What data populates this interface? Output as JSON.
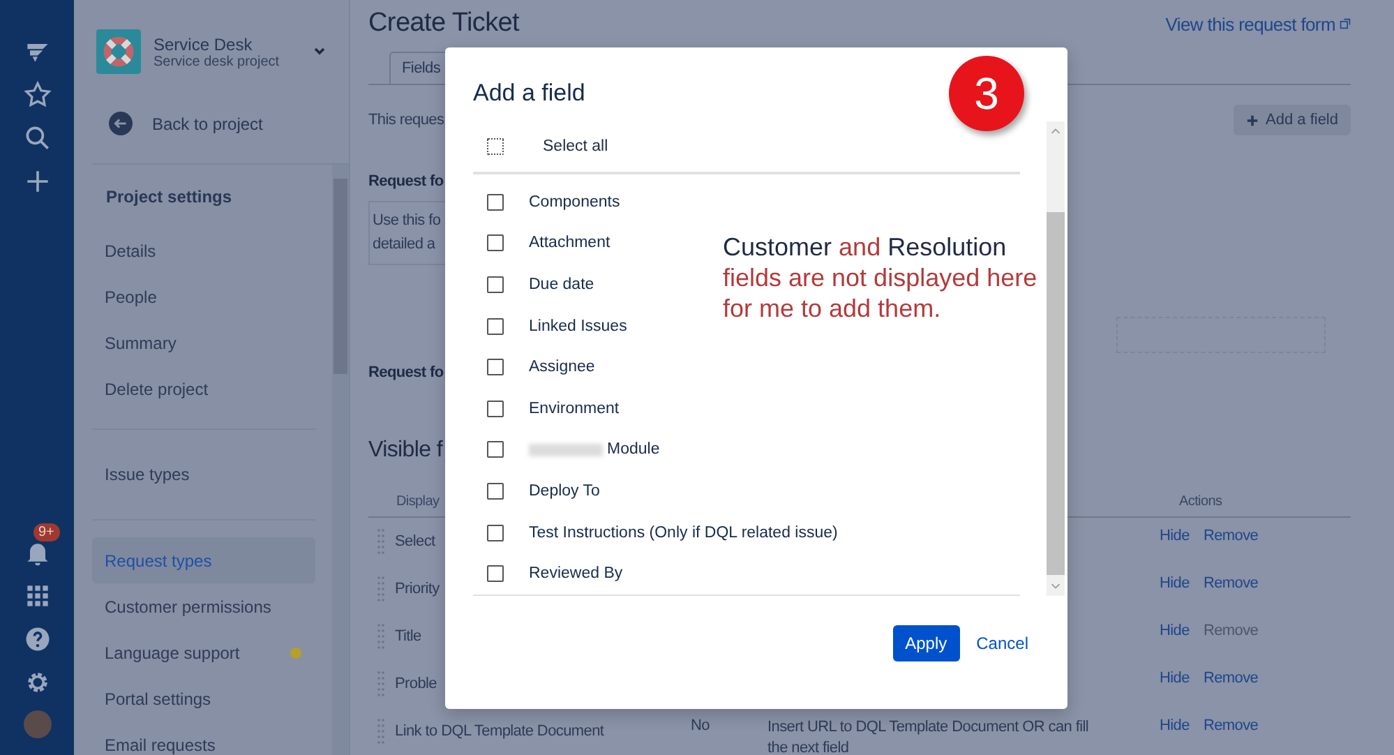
{
  "nav": {
    "badge": "9+"
  },
  "sidebar": {
    "project_name": "Service Desk",
    "project_type": "Service desk project",
    "back_link": "Back to project",
    "groups": [
      {
        "heading": "Project settings",
        "items": [
          {
            "label": "Details",
            "selected": false
          },
          {
            "label": "People",
            "selected": false
          },
          {
            "label": "Summary",
            "selected": false
          },
          {
            "label": "Delete project",
            "selected": false
          }
        ]
      },
      {
        "items": [
          {
            "label": "Issue types",
            "selected": false
          }
        ]
      },
      {
        "items": [
          {
            "label": "Request types",
            "selected": true
          },
          {
            "label": "Customer permissions",
            "selected": false
          },
          {
            "label": "Language support",
            "selected": false,
            "dot": {
              "color": "#b5a02a"
            }
          },
          {
            "label": "Portal settings",
            "selected": false
          },
          {
            "label": "Email requests",
            "selected": false
          }
        ]
      }
    ]
  },
  "page": {
    "title": "Create Ticket",
    "view_link": "View this request form",
    "tabs": [
      {
        "label": "Fields",
        "selected": true
      }
    ],
    "intro": "This reques",
    "add_field_button": "Add a field",
    "form_label_1": "Request fo",
    "description_lines": [
      "Use this fo",
      "detailed a"
    ],
    "form_label_2": "Request fo",
    "section_heading": "Visible f",
    "table": {
      "columns": [
        "Display",
        "Actions"
      ],
      "rows": [
        {
          "name": "Select",
          "actions": [
            {
              "label": "Hide",
              "disabled": false
            },
            {
              "label": "Remove",
              "disabled": false
            }
          ]
        },
        {
          "name": "Priority",
          "actions": [
            {
              "label": "Hide",
              "disabled": false
            },
            {
              "label": "Remove",
              "disabled": false
            }
          ]
        },
        {
          "name": "Title",
          "actions": [
            {
              "label": "Hide",
              "disabled": false
            },
            {
              "label": "Remove",
              "disabled": true
            }
          ]
        },
        {
          "name": "Proble",
          "actions": [
            {
              "label": "Hide",
              "disabled": false
            },
            {
              "label": "Remove",
              "disabled": false
            }
          ]
        },
        {
          "name": "Link to DQL Template Document",
          "required": "No",
          "help": [
            "Insert URL to DQL Template Document OR can fill",
            "the next field"
          ],
          "actions": [
            {
              "label": "Hide",
              "disabled": false
            },
            {
              "label": "Remove",
              "disabled": false
            }
          ]
        }
      ]
    }
  },
  "dialog": {
    "title": "Add a field",
    "step_badge": "3",
    "select_all": {
      "label": "Select all",
      "checked": false
    },
    "fields": [
      {
        "label": "Components",
        "checked": false
      },
      {
        "label": "Attachment",
        "checked": false
      },
      {
        "label": "Due date",
        "checked": false
      },
      {
        "label": "Linked Issues",
        "checked": false
      },
      {
        "label": "Assignee",
        "checked": false
      },
      {
        "label": "Environment",
        "checked": false
      },
      {
        "label": "Module",
        "checked": false,
        "redacted_prefix": true
      },
      {
        "label": "Deploy To",
        "checked": false
      },
      {
        "label": "Test Instructions (Only if DQL related issue)",
        "checked": false
      },
      {
        "label": "Reviewed By",
        "checked": false
      }
    ],
    "annotation": [
      {
        "text": "Customer",
        "color": "#1f2a44"
      },
      {
        "text": "and",
        "color": "#b33a3a"
      },
      {
        "text": "Resolution",
        "color": "#1f2a44"
      },
      {
        "text": "fields are not displayed here for me to add them.",
        "color": "#b33a3a"
      }
    ],
    "apply_button": "Apply",
    "cancel_link": "Cancel"
  }
}
